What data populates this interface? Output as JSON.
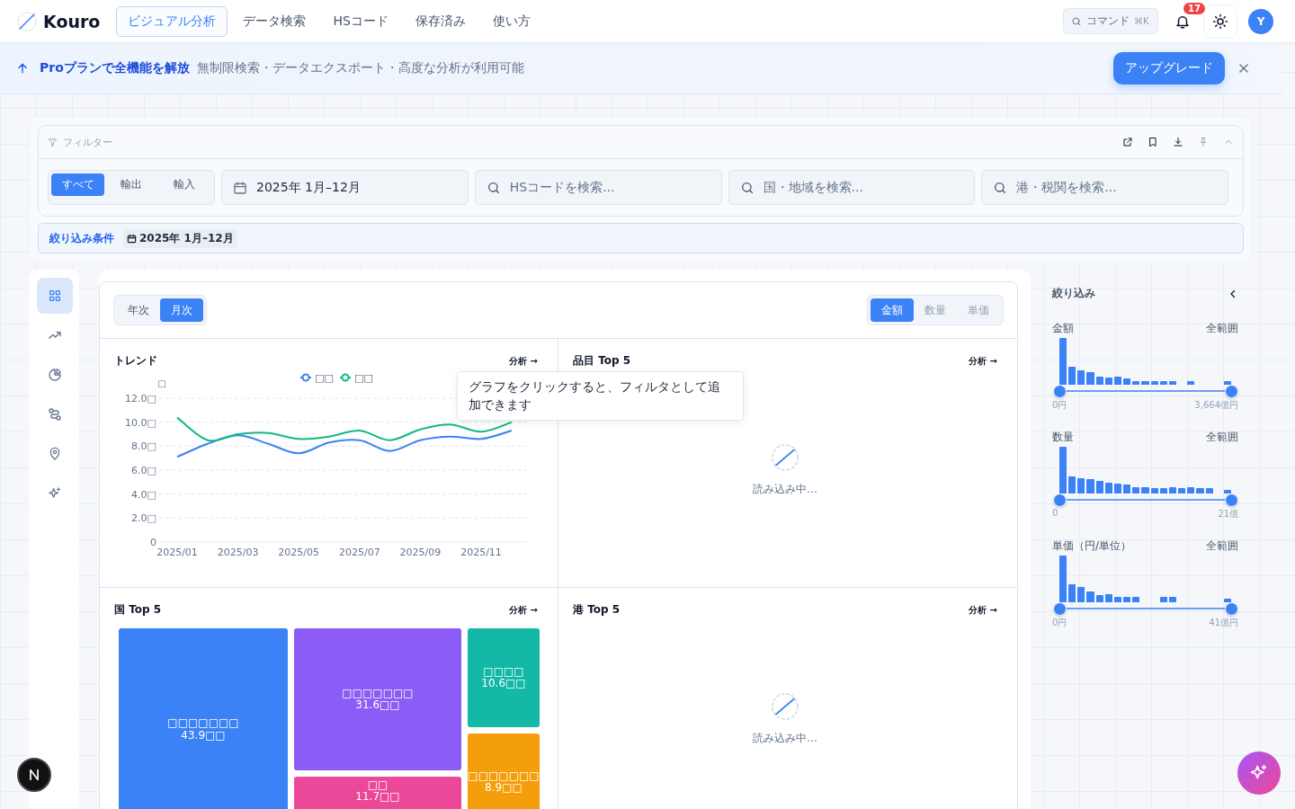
{
  "nav": {
    "brand": "Kouro",
    "tabs": [
      {
        "label": "ビジュアル分析",
        "selected": true
      },
      {
        "label": "データ検索",
        "selected": false
      },
      {
        "label": "HSコード",
        "selected": false
      },
      {
        "label": "保存済み",
        "selected": false
      },
      {
        "label": "使い方",
        "selected": false
      }
    ],
    "command": {
      "placeholder": "コマンド",
      "shortcut": "⌘K"
    },
    "notification_count": "17",
    "avatar": "Y"
  },
  "banner": {
    "title": "Proプランで全機能を解放",
    "text": "無制限検索・データエクスポート・高度な分析が利用可能",
    "button": "アップグレード"
  },
  "filter": {
    "title": "フィルター",
    "direction": [
      {
        "label": "すべて",
        "selected": true
      },
      {
        "label": "輸出",
        "selected": false
      },
      {
        "label": "輸入",
        "selected": false
      }
    ],
    "period": "2025年 1月–12月",
    "searches": [
      {
        "placeholder": "HSコードを検索..."
      },
      {
        "placeholder": "国・地域を検索..."
      },
      {
        "placeholder": "港・税関を検索..."
      }
    ],
    "conditions_label": "絞り込み条件",
    "condition_chips": [
      "2025年 1月–12月"
    ]
  },
  "sidebar": {
    "items": [
      {
        "kind": "grid",
        "selected": true
      },
      {
        "kind": "trend",
        "selected": false
      },
      {
        "kind": "pie",
        "selected": false
      },
      {
        "kind": "route",
        "selected": false
      },
      {
        "kind": "pin",
        "selected": false
      },
      {
        "kind": "sparkle",
        "selected": false
      }
    ]
  },
  "view": {
    "period_tabs": [
      {
        "label": "年次",
        "selected": false
      },
      {
        "label": "月次",
        "selected": true
      }
    ],
    "metric_tabs": [
      {
        "label": "金額",
        "selected": true
      },
      {
        "label": "数量",
        "selected": false
      },
      {
        "label": "単価",
        "selected": false
      }
    ]
  },
  "panels": [
    {
      "kind": "chart",
      "title": "トレンド",
      "link": "分析 →",
      "chart_data": {
        "type": "line",
        "ylabel": "□",
        "categories": [
          "2025/01",
          null,
          "2025/03",
          null,
          "2025/05",
          null,
          "2025/07",
          null,
          "2025/09",
          null,
          "2025/11",
          null
        ],
        "grid": true,
        "series": [
          {
            "name": "□□",
            "color": "#3b82f6",
            "values": [
              7.1,
              8.2,
              8.9,
              8.2,
              7.4,
              8.3,
              8.5,
              7.6,
              8.5,
              8.8,
              8.6,
              9.3
            ]
          },
          {
            "name": "□□",
            "color": "#10b981",
            "values": [
              10.4,
              8.5,
              9.0,
              9.1,
              8.6,
              8.8,
              9.3,
              8.5,
              9.4,
              9.8,
              9.2,
              10.0
            ]
          }
        ],
        "ylim": [
          0,
          12
        ],
        "yticks": [
          {
            "value": 0,
            "label": "0"
          },
          {
            "value": 2,
            "label": "2.0□"
          },
          {
            "value": 4,
            "label": "4.0□"
          },
          {
            "value": 6,
            "label": "6.0□"
          },
          {
            "value": 8,
            "label": "8.0□"
          },
          {
            "value": 10,
            "label": "10.0□"
          },
          {
            "value": 12,
            "label": "12.0□"
          }
        ]
      }
    },
    {
      "kind": "loading",
      "title": "品目 Top 5",
      "link": "分析 →",
      "message": "読み込み中..."
    },
    {
      "kind": "treemap",
      "title": "国 Top 5",
      "link": "分析 →",
      "items": [
        {
          "name": "□□□□□□□",
          "value": "43.9□□",
          "color": "#3b82f6"
        },
        {
          "name": "□□□□□□□",
          "value": "31.6□□",
          "color": "#8b5cf6"
        },
        {
          "name": "□□",
          "value": "11.7□□",
          "color": "#ec4899"
        },
        {
          "name": "□□□□",
          "value": "10.6□□",
          "color": "#14b8a6"
        },
        {
          "name": "□□□□□□□",
          "value": "8.9□□",
          "color": "#f59e0b"
        }
      ]
    },
    {
      "kind": "loading",
      "title": "港 Top 5",
      "link": "分析 →",
      "message": "読み込み中..."
    }
  ],
  "tooltip": "グラフをクリックすると、フィルタとして追加できます",
  "refine": {
    "title": "絞り込み",
    "ranges": [
      {
        "label": "金額",
        "range": "全範囲",
        "min": "0円",
        "max": "3,664億円",
        "level": 1
      },
      {
        "label": "数量",
        "range": "全範囲",
        "min": "0",
        "max": "21億",
        "level": 1
      },
      {
        "label": "単価（円/単位）",
        "range": "全範囲",
        "min": "0円",
        "max": "41億円",
        "level": 1
      }
    ]
  }
}
